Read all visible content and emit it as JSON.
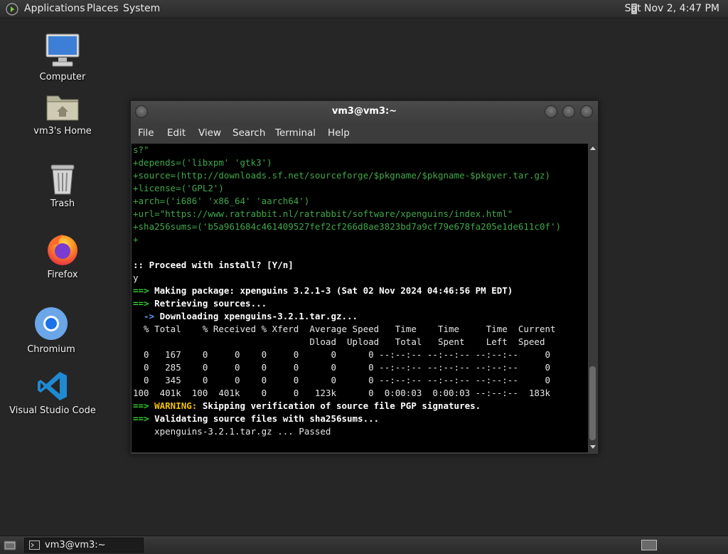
{
  "top_panel": {
    "menus": [
      "Applications",
      "Places",
      "System"
    ],
    "clock": "Sat Nov 2, 4:47 PM"
  },
  "desktop": {
    "icons": [
      {
        "label": "Computer",
        "icon": "computer-icon"
      },
      {
        "label": "vm3's Home",
        "icon": "home-folder-icon"
      },
      {
        "label": "Trash",
        "icon": "trash-icon"
      },
      {
        "label": "Firefox",
        "icon": "firefox-icon"
      },
      {
        "label": "Chromium",
        "icon": "chromium-icon"
      },
      {
        "label": "Visual Studio Code",
        "icon": "vscode-icon"
      }
    ]
  },
  "terminal": {
    "title": "vm3@vm3:~",
    "menu": [
      "File",
      "Edit",
      "View",
      "Search",
      "Terminal",
      "Help"
    ],
    "lines": [
      "s?\"",
      "+depends=('libxpm' 'gtk3')",
      "+source=(http://downloads.sf.net/sourceforge/$pkgname/$pkgname-$pkgver.tar.gz)",
      "+license=('GPL2')",
      "+arch=('i686' 'x86_64' 'aarch64')",
      "+url=\"https://www.ratrabbit.nl/ratrabbit/software/xpenguins/index.html\"",
      "+sha256sums=('b5a961684c461409527fef2cf266d8ae3823bd7a9cf79e678fa205e1de611c0f')",
      "+",
      "",
      ":: Proceed with install? [Y/n]",
      "y",
      "==> Making package: xpenguins 3.2.1-3 (Sat 02 Nov 2024 04:46:56 PM EDT)",
      "==> Retrieving sources...",
      "  -> Downloading xpenguins-3.2.1.tar.gz...",
      "  % Total    % Received % Xferd  Average Speed   Time    Time     Time  Current",
      "                                 Dload  Upload   Total   Spent    Left  Speed",
      "  0   167    0     0    0     0      0      0 --:--:-- --:--:-- --:--:--     0",
      "  0   285    0     0    0     0      0      0 --:--:-- --:--:-- --:--:--     0",
      "  0   345    0     0    0     0      0      0 --:--:-- --:--:-- --:--:--     0",
      "100  401k  100  401k    0     0   123k      0  0:00:03  0:00:03 --:--:--  183k",
      "==> WARNING: Skipping verification of source file PGP signatures.",
      "==> Validating source files with sha256sums...",
      "    xpenguins-3.2.1.tar.gz ... Passed"
    ]
  },
  "taskbar": {
    "task_label": "vm3@vm3:~"
  }
}
